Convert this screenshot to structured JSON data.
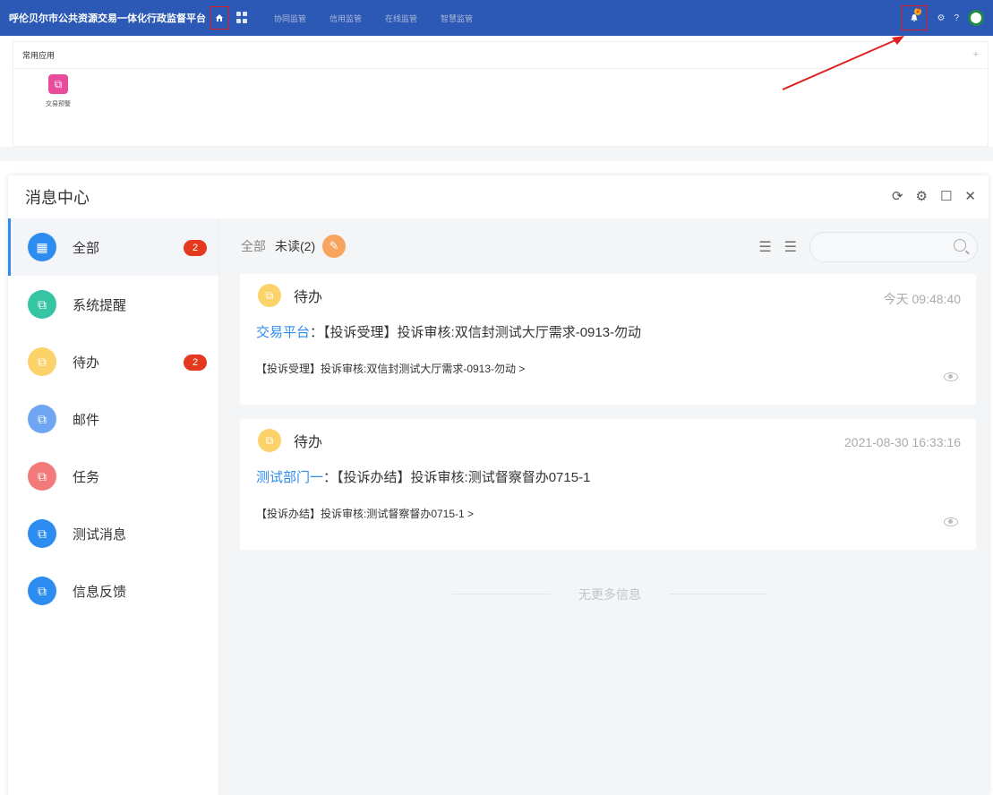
{
  "topbar": {
    "title": "呼伦贝尔市公共资源交易一体化行政监督平台",
    "nav": [
      "协同监管",
      "信用监管",
      "在线监管",
      "智慧监管"
    ],
    "notification_count": "2",
    "help": "?"
  },
  "common_apps": {
    "heading": "常用应用",
    "add": "+",
    "apps": [
      {
        "label": "交易预警"
      }
    ]
  },
  "message_center": {
    "title": "消息中心",
    "controls": [
      "refresh-icon",
      "gear-icon",
      "maximize-icon",
      "close-icon"
    ],
    "sidebar": [
      {
        "label": "全部",
        "badge": "2",
        "color": "#2d8cf0"
      },
      {
        "label": "系统提醒",
        "badge": "",
        "color": "#36c5a3"
      },
      {
        "label": "待办",
        "badge": "2",
        "color": "#fcd36a"
      },
      {
        "label": "邮件",
        "badge": "",
        "color": "#6fa6f3"
      },
      {
        "label": "任务",
        "badge": "",
        "color": "#f27a7a"
      },
      {
        "label": "测试消息",
        "badge": "",
        "color": "#2d8cf0"
      },
      {
        "label": "信息反馈",
        "badge": "",
        "color": "#2d8cf0"
      }
    ],
    "toolbar": {
      "all": "全部",
      "unread": "未读(2)",
      "search_placeholder": ""
    },
    "messages": [
      {
        "type": "待办",
        "time": "今天 09:48:40",
        "source": "交易平台",
        "separator": "：",
        "title": "【投诉受理】投诉审核:双信封测试大厅需求-0913-勿动",
        "summary": "【投诉受理】投诉审核:双信封测试大厅需求-0913-勿动 >"
      },
      {
        "type": "待办",
        "time": "2021-08-30 16:33:16",
        "source": "测试部门一",
        "separator": "：",
        "title": "【投诉办结】投诉审核:测试督察督办0715-1",
        "summary": "【投诉办结】投诉审核:测试督察督办0715-1 >"
      }
    ],
    "no_more": "无更多信息"
  }
}
